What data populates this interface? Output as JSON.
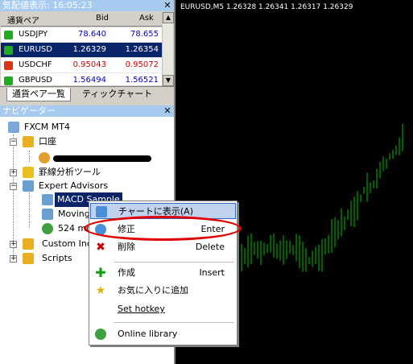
{
  "market_watch": {
    "title": "気配値表示: 16:05:23",
    "col_symbol": "通貨ペア",
    "col_bid": "Bid",
    "col_ask": "Ask",
    "rows": [
      {
        "symbol": "USDJPY",
        "bid": "78.640",
        "ask": "78.655",
        "bid_color": "#0000c0",
        "ask_color": "#0000c0",
        "icon": "up-arrow-icon"
      },
      {
        "symbol": "EURUSD",
        "bid": "1.26329",
        "ask": "1.26354",
        "bid_color": "#ffffff",
        "ask_color": "#ffffff",
        "icon": "up-arrow-icon"
      },
      {
        "symbol": "USDCHF",
        "bid": "0.95043",
        "ask": "0.95072",
        "bid_color": "#d00000",
        "ask_color": "#d00000",
        "icon": "down-arrow-icon"
      },
      {
        "symbol": "GBPUSD",
        "bid": "1.56494",
        "ask": "1.56521",
        "bid_color": "#0000c0",
        "ask_color": "#0000c0",
        "icon": "up-arrow-icon"
      }
    ],
    "tab_pairs": "通貨ペア一覧",
    "tab_tick": "ティックチャート"
  },
  "navigator": {
    "title": "ナビゲーター",
    "root": "FXCM MT4",
    "accounts": "口座",
    "indicators": "罫線分析ツール",
    "expert_advisors": "Expert Advisors",
    "ea_items": [
      "MACD Sample",
      "Moving",
      "524 mo"
    ],
    "custom_indicators": "Custom Ind",
    "scripts": "Scripts"
  },
  "chart": {
    "title": "EURUSD,M5  1.26328 1.26341 1.26317 1.26329",
    "up_color": "#00c000"
  },
  "context_menu": {
    "items": [
      {
        "label": "チャートに表示(A)",
        "shortcut": "",
        "icon": "chart-icon"
      },
      {
        "label": "修正",
        "shortcut": "Enter",
        "icon": "gear-icon"
      },
      {
        "label": "削除",
        "shortcut": "Delete",
        "icon": "delete-icon"
      },
      {
        "label": "作成",
        "shortcut": "Insert",
        "icon": "plus-icon"
      },
      {
        "label": "お気に入りに追加",
        "shortcut": "",
        "icon": "star-icon"
      },
      {
        "label": "Set hotkey",
        "shortcut": "",
        "icon": ""
      },
      {
        "label": "Online library",
        "shortcut": "",
        "icon": "globe-icon"
      }
    ]
  }
}
